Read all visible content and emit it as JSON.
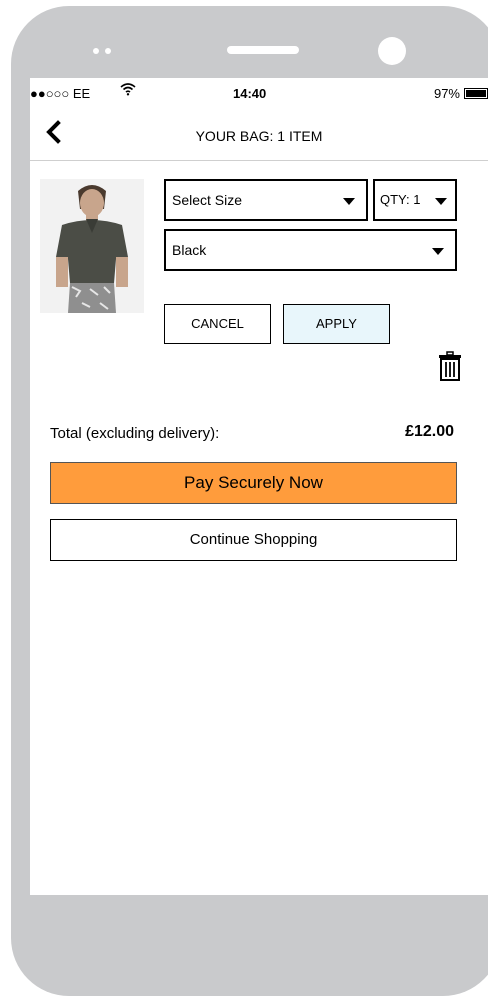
{
  "status_bar": {
    "carrier": "●●○○○ EE",
    "time": "14:40",
    "battery": "97%"
  },
  "header": {
    "title": "YOUR BAG: 1 ITEM",
    "back_icon": "chevron-left-icon"
  },
  "item": {
    "image": "product-photo",
    "size_select": "Select Size",
    "qty_select": "QTY: 1",
    "color_select": "Black"
  },
  "actions": {
    "cancel_label": "CANCEL",
    "apply_label": "APPLY",
    "delete_icon": "trash-icon"
  },
  "totals": {
    "label": "Total (excluding delivery):",
    "value": "£12.00"
  },
  "buttons": {
    "pay_label": "Pay Securely Now",
    "continue_label": "Continue Shopping"
  },
  "colors": {
    "pay_button": "#ff9c3c",
    "apply_button": "#e8f6fb",
    "phone_frame": "#c9cacc"
  }
}
